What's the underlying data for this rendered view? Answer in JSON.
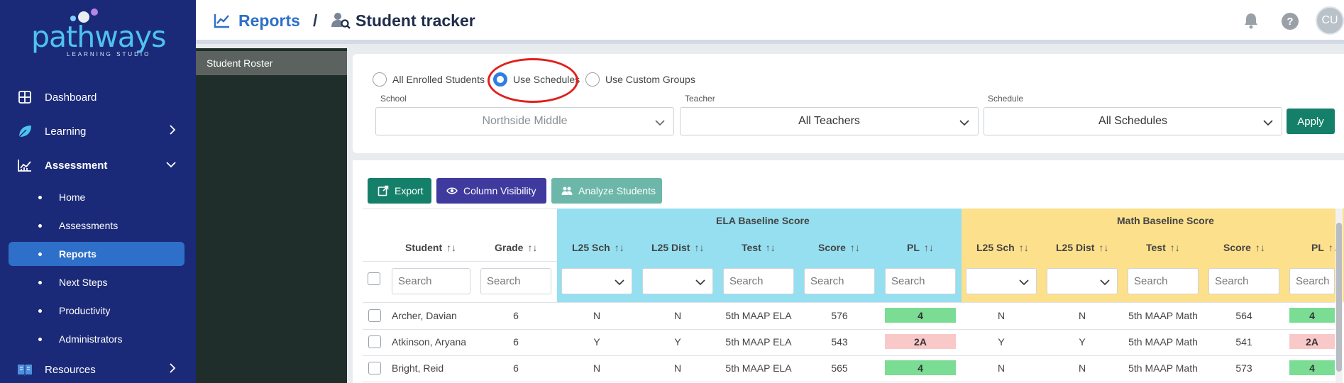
{
  "brand": {
    "name": "pathways",
    "subtitle": "LEARNING STUDIO"
  },
  "sidebar": {
    "items": [
      {
        "label": "Dashboard"
      },
      {
        "label": "Learning"
      },
      {
        "label": "Assessment"
      },
      {
        "label": "Resources"
      }
    ],
    "subitems": [
      {
        "label": "Home"
      },
      {
        "label": "Assessments"
      },
      {
        "label": "Reports"
      },
      {
        "label": "Next Steps"
      },
      {
        "label": "Productivity"
      },
      {
        "label": "Administrators"
      }
    ]
  },
  "header": {
    "crumb_reports": "Reports",
    "crumb_sep": "/",
    "title": "Student tracker",
    "help": "?",
    "avatar": "CU"
  },
  "panel2": {
    "item": "Student Roster"
  },
  "filters": {
    "radios": [
      {
        "label": "All Enrolled Students",
        "selected": false
      },
      {
        "label": "Use Schedules",
        "selected": true
      },
      {
        "label": "Use Custom Groups",
        "selected": false
      }
    ],
    "school_label": "School",
    "school_value": "Northside Middle",
    "teacher_label": "Teacher",
    "teacher_value": "All Teachers",
    "schedule_label": "Schedule",
    "schedule_value": "All Schedules",
    "apply": "Apply"
  },
  "toolbar": {
    "export": "Export",
    "column_visibility": "Column Visibility",
    "analyze": "Analyze Students"
  },
  "table": {
    "groups": {
      "ela": "ELA Baseline Score",
      "math": "Math Baseline Score"
    },
    "columns": {
      "student": "Student",
      "grade": "Grade",
      "ela_l25sch": "L25 Sch",
      "ela_l25dist": "L25 Dist",
      "ela_test": "Test",
      "ela_score": "Score",
      "ela_pl": "PL",
      "math_l25sch": "L25 Sch",
      "math_l25dist": "L25 Dist",
      "math_test": "Test",
      "math_score": "Score",
      "math_pl": "PL",
      "sort_glyph": "↑↓"
    },
    "search_placeholder": "Search",
    "rows": [
      {
        "student": "Archer, Davian",
        "grade": "6",
        "ela_sch": "N",
        "ela_dist": "N",
        "ela_test": "5th MAAP ELA",
        "ela_score": "576",
        "ela_pl": "4",
        "math_sch": "N",
        "math_dist": "N",
        "math_test": "5th MAAP Math",
        "math_score": "564",
        "math_pl": "4"
      },
      {
        "student": "Atkinson, Aryana",
        "grade": "6",
        "ela_sch": "Y",
        "ela_dist": "Y",
        "ela_test": "5th MAAP ELA",
        "ela_score": "543",
        "ela_pl": "2A",
        "math_sch": "Y",
        "math_dist": "Y",
        "math_test": "5th MAAP Math",
        "math_score": "541",
        "math_pl": "2A"
      },
      {
        "student": "Bright, Reid",
        "grade": "6",
        "ela_sch": "N",
        "ela_dist": "N",
        "ela_test": "5th MAAP ELA",
        "ela_score": "565",
        "ela_pl": "4",
        "math_sch": "N",
        "math_dist": "N",
        "math_test": "5th MAAP Math",
        "math_score": "573",
        "math_pl": "4"
      }
    ]
  },
  "colors": {
    "sidebar": "#1b2a78",
    "active": "#2e6fc9",
    "ela": "#95dff0",
    "math": "#fde08c",
    "pl_good": "#7bdc94",
    "pl_low": "#f9c9c9",
    "apply": "#15806a"
  }
}
